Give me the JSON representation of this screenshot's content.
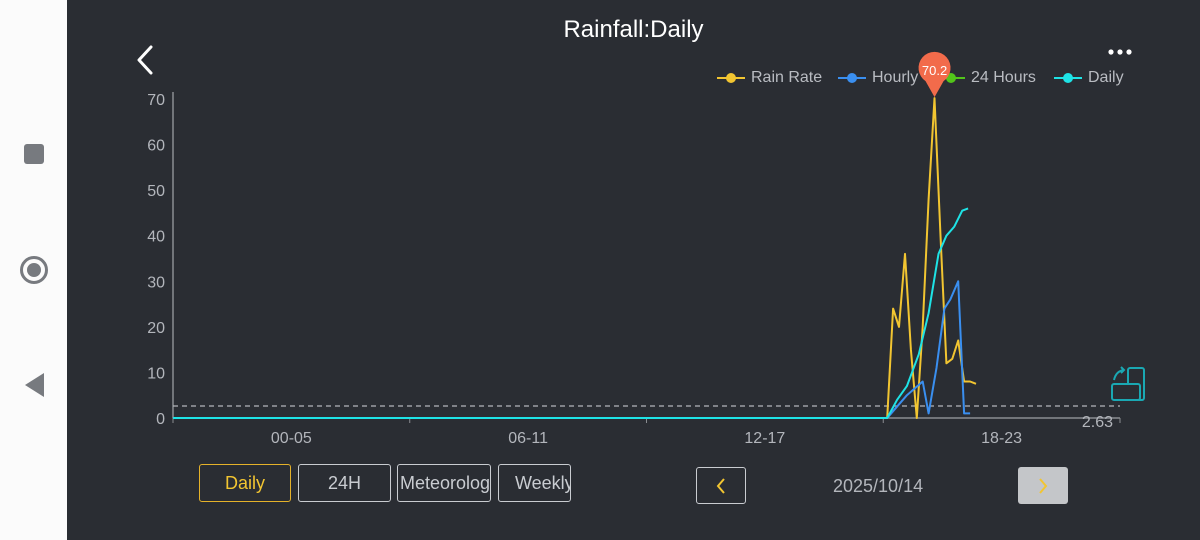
{
  "header": {
    "title": "Rainfall:Daily"
  },
  "legend": [
    {
      "label": "Rain Rate",
      "color": "#f2c531"
    },
    {
      "label": "Hourly",
      "color": "#3a8ff0"
    },
    {
      "label": "24 Hours",
      "color": "#52c41a"
    },
    {
      "label": "Daily",
      "color": "#1ee3e6"
    }
  ],
  "tooltip": {
    "value": "70.2",
    "color": "#f26b4b"
  },
  "tabs": [
    {
      "label": "Daily",
      "active": true
    },
    {
      "label": "24H",
      "active": false
    },
    {
      "label": "Meteorology",
      "active": false
    },
    {
      "label": "Weekly",
      "active": false
    }
  ],
  "date_nav": {
    "date": "2025/10/14"
  },
  "chart_data": {
    "type": "line",
    "yticks": [
      "0",
      "10",
      "20",
      "30",
      "40",
      "50",
      "60",
      "70"
    ],
    "xticks": [
      "00-05",
      "06-11",
      "12-17",
      "18-23"
    ],
    "ylim": [
      0,
      70
    ],
    "xlim": [
      0,
      24
    ],
    "reference_line": {
      "value": 2.63,
      "label": "2.63"
    },
    "series": [
      {
        "name": "Rain Rate",
        "color": "#f2c531",
        "x": [
          0,
          18.1,
          18.25,
          18.4,
          18.55,
          18.7,
          18.85,
          19.0,
          19.15,
          19.3,
          19.45,
          19.6,
          19.75,
          19.9,
          20.05,
          20.2,
          20.35
        ],
        "y": [
          0,
          0,
          24,
          20,
          36,
          15,
          0,
          20,
          48,
          70.2,
          40,
          12,
          13,
          17,
          8,
          8,
          7.5
        ]
      },
      {
        "name": "Hourly",
        "color": "#3a8ff0",
        "x": [
          0,
          18.1,
          18.6,
          19.0,
          19.15,
          19.35,
          19.55,
          19.7,
          19.9,
          20.05,
          20.2
        ],
        "y": [
          0,
          0,
          5,
          8,
          1,
          11,
          24,
          26,
          30,
          1,
          1
        ]
      },
      {
        "name": "24 Hours",
        "color": "#52c41a",
        "x": [],
        "y": []
      },
      {
        "name": "Daily",
        "color": "#1ee3e6",
        "x": [
          0,
          18.1,
          18.35,
          18.6,
          18.9,
          19.15,
          19.4,
          19.6,
          19.8,
          20.0,
          20.15
        ],
        "y": [
          0,
          0,
          4,
          7,
          14,
          23,
          36,
          40,
          42,
          45.5,
          46
        ]
      }
    ]
  }
}
